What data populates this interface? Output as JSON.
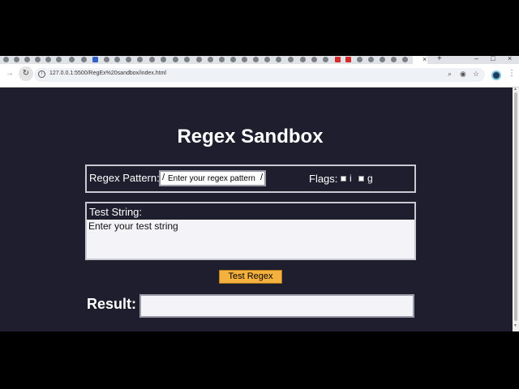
{
  "browser": {
    "url": "127.0.0.1:5500/RegEx%20sandbox/index.html",
    "tab_close": "×",
    "new_tab": "+",
    "window_controls": [
      "–",
      "□",
      "×"
    ]
  },
  "page": {
    "title": "Regex Sandbox",
    "pattern_label": "Regex Pattern:",
    "pattern_open_slash": "/",
    "pattern_placeholder": "Enter your regex pattern",
    "pattern_close_slash": "/",
    "flags_label": "Flags:",
    "flags": [
      {
        "label": "i",
        "checked": false
      },
      {
        "label": "g",
        "checked": false
      }
    ],
    "test_label": "Test String:",
    "test_placeholder": "Enter your test string",
    "button_label": "Test Regex",
    "result_label": "Result:",
    "result_value": ""
  },
  "colors": {
    "page_background": "#1e1e2f",
    "button": "#f5b13f",
    "text": "#ffffff"
  }
}
